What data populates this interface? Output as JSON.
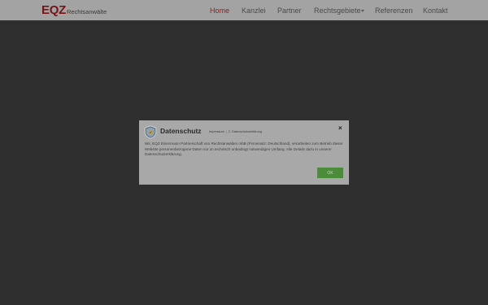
{
  "header": {
    "logo_mark": "EQZ",
    "logo_sub": "Rechtsanwälte",
    "nav": [
      {
        "label": "Home",
        "active": true
      },
      {
        "label": "Kanzlei"
      },
      {
        "label": "Partner"
      },
      {
        "label": "Rechtsgebiete",
        "has_dropdown": true
      },
      {
        "label": "Referenzen"
      },
      {
        "label": "Kontakt"
      }
    ]
  },
  "modal": {
    "title": "Datenschutz",
    "links": [
      "Impressum",
      "2. Datenschutzerklärung"
    ],
    "link_separator": "|",
    "close_label": "×",
    "body": "Wir, EQZ Eisenmann Partnerschaft von Rechtsanwälten mbB (Firmensitz: Deutschland), verarbeiten zum Betrieb dieser Website personenbezogene Daten nur im technisch unbedingt notwendigen Umfang. Alle Details dazu in unserer Datenschutzerklärung.",
    "ok_label": "OK"
  },
  "colors": {
    "brand": "#7a1414",
    "active_nav": "#8a1f1f",
    "ok_button": "#4a8c3a",
    "overlay_bg": "#2f2f2f"
  },
  "icons": {
    "modal_icon": "shield-check-icon",
    "close": "close-icon",
    "dropdown": "chevron-down-icon"
  }
}
